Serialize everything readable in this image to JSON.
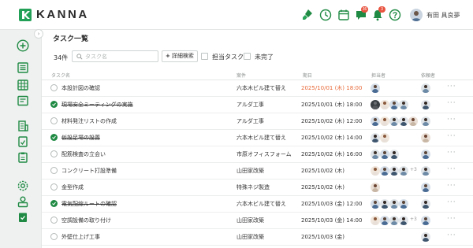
{
  "app": {
    "brand": "KANNA",
    "colors": {
      "brand_green": "#23a057",
      "accent_orange": "#e86a3a",
      "done_green": "#1f8a43"
    }
  },
  "header": {
    "icons": [
      "brush-icon",
      "clock-icon",
      "calendar-icon",
      "chat-icon",
      "bell-icon",
      "help-icon"
    ],
    "chat_badge": "36",
    "bell_badge": "3",
    "user_name": "有田 具良夢"
  },
  "sidebar": {
    "icons": [
      "add-icon",
      "list-icon",
      "grid-icon",
      "panel-icon",
      "building-icon",
      "report-icon",
      "checklist-icon",
      "settings-icon",
      "person-icon",
      "clipboard-icon"
    ]
  },
  "page": {
    "title": "タスク一覧"
  },
  "toolbar": {
    "count": "34件",
    "search_placeholder": "タスク名",
    "search_value": "",
    "advanced_search": "詳細検索",
    "advanced_plus": "+",
    "filter_assigned": "担当タスク",
    "filter_incomplete": "未完了"
  },
  "table": {
    "headers": {
      "name": "タスク名",
      "project": "案件",
      "due": "期日",
      "assignees": "担当者",
      "requester": "依頼者"
    },
    "rows": [
      {
        "name": "本設計図の確認",
        "done": false,
        "project": "六本木ビル建て替え",
        "due": "2025/10/01 (木) 18:00",
        "overdue": true,
        "assignees": [
          "m1"
        ],
        "extra": "",
        "requester": "m2"
      },
      {
        "name": "現場安全ミーティングの実施",
        "done": true,
        "project": "アルダ工事",
        "due": "2025/10/01 (木) 18:00",
        "overdue": false,
        "assignees": [
          "d1",
          "f1",
          "m1",
          "m2"
        ],
        "extra": "",
        "requester": "m3"
      },
      {
        "name": "材料発注リストの作成",
        "done": false,
        "project": "アルダ工事",
        "due": "2025/10/02 (木) 12:00",
        "overdue": false,
        "assignees": [
          "m1",
          "f1",
          "m2",
          "m3",
          "f2"
        ],
        "extra": "",
        "requester": "m2"
      },
      {
        "name": "仮設足場の設置",
        "done": true,
        "project": "六本木ビル建て替え",
        "due": "2025/10/02 (木) 14:00",
        "overdue": false,
        "assignees": [
          "m3",
          "f1"
        ],
        "extra": "",
        "requester": "f2"
      },
      {
        "name": "配筋検査の立会い",
        "done": false,
        "project": "市原オフィスフォーム",
        "due": "2025/10/02 (木) 16:00",
        "overdue": false,
        "assignees": [
          "m2",
          "m1",
          "m3"
        ],
        "extra": "",
        "requester": "m1"
      },
      {
        "name": "コンクリート打設準備",
        "done": false,
        "project": "山田家改築",
        "due": "2025/10/02 (木)",
        "overdue": false,
        "assignees": [
          "f1",
          "m1",
          "m3",
          "m2"
        ],
        "extra": "+3",
        "requester": "m2"
      },
      {
        "name": "金型作成",
        "done": false,
        "project": "特殊ネジ製造",
        "due": "2025/10/02 (木)",
        "overdue": false,
        "assignees": [
          "f2"
        ],
        "extra": "",
        "requester": "m1"
      },
      {
        "name": "電気配線ルートの確認",
        "done": true,
        "project": "六本木ビル建て替え",
        "due": "2025/10/03 (金) 12:00",
        "overdue": false,
        "assignees": [
          "m1",
          "m3",
          "m2",
          "m1"
        ],
        "extra": "",
        "requester": "m3"
      },
      {
        "name": "空調設備の取り付け",
        "done": false,
        "project": "山田家改築",
        "due": "2025/10/03 (金) 14:00",
        "overdue": false,
        "assignees": [
          "f1",
          "m1",
          "m2",
          "m3"
        ],
        "extra": "+3",
        "requester": "m1"
      },
      {
        "name": "外壁仕上げ工事",
        "done": false,
        "project": "山田家改築",
        "due": "2025/10/03 (金)",
        "overdue": false,
        "assignees": [],
        "extra": "",
        "requester": "m3"
      }
    ]
  }
}
